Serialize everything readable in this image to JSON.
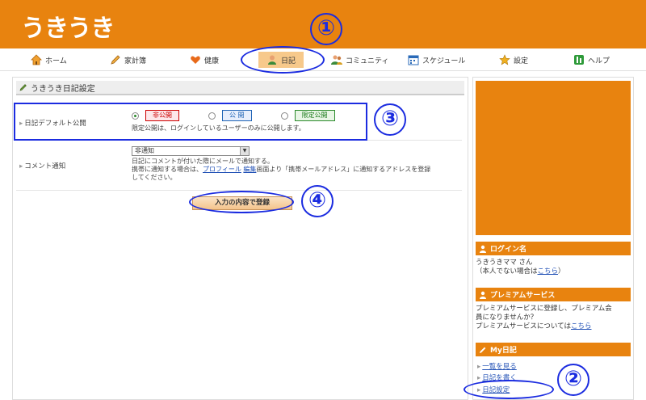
{
  "app": {
    "logo": "うきうき"
  },
  "nav": {
    "items": [
      {
        "label": "ホーム",
        "icon": "home-icon"
      },
      {
        "label": "家計簿",
        "icon": "pencil-icon"
      },
      {
        "label": "健康",
        "icon": "heart-icon"
      },
      {
        "label": "日記",
        "icon": "person-icon",
        "active": true
      },
      {
        "label": "コミュニティ",
        "icon": "people-icon"
      },
      {
        "label": "スケジュール",
        "icon": "calendar-icon"
      },
      {
        "label": "設定",
        "icon": "star-icon"
      },
      {
        "label": "ヘルプ",
        "icon": "help-book-icon"
      }
    ]
  },
  "main": {
    "section_title": "うきうき日記設定",
    "default_public": {
      "label": "日記デフォルト公開",
      "options": [
        "非公開",
        "公 開",
        "限定公開"
      ],
      "selected": "非公開",
      "note": "限定公開は、ログインしているユーザーのみに公開します。"
    },
    "comment_notify": {
      "label": "コメント通知",
      "select_value": "非通知",
      "note1": "日記にコメントが付いた際にメールで通知する。",
      "note2_prefix": "携帯に通知する場合は、",
      "note2_link1": "プロフィール",
      "note2_link2": "編集",
      "note2_mid": "画面より「携帯メールアドレス」に通知するアドレスを登録",
      "note2_suffix": "してください。"
    },
    "submit_label": "入力の内容で登録"
  },
  "sidebar": {
    "login": {
      "title": "ログイン名",
      "user": "うきうきママ さん",
      "not_me_prefix": "（本人でない場合は",
      "not_me_link": "こちら",
      "not_me_suffix": "）"
    },
    "premium": {
      "title": "プレミアムサービス",
      "line1": "プレミアムサービスに登録し、プレミアム会",
      "line2": "員になりませんか？",
      "line3_prefix": "プレミアムサービスについては",
      "line3_link": "こちら"
    },
    "mydiary": {
      "title": "My日記",
      "links": [
        "一覧を見る",
        "日記を書く",
        "日記設定"
      ]
    }
  },
  "annotations": [
    "①",
    "②",
    "③",
    "④"
  ],
  "colors": {
    "brand_orange": "#e8830f",
    "annotation_blue": "#1b2ce0",
    "link_blue": "#1f4fb5"
  }
}
